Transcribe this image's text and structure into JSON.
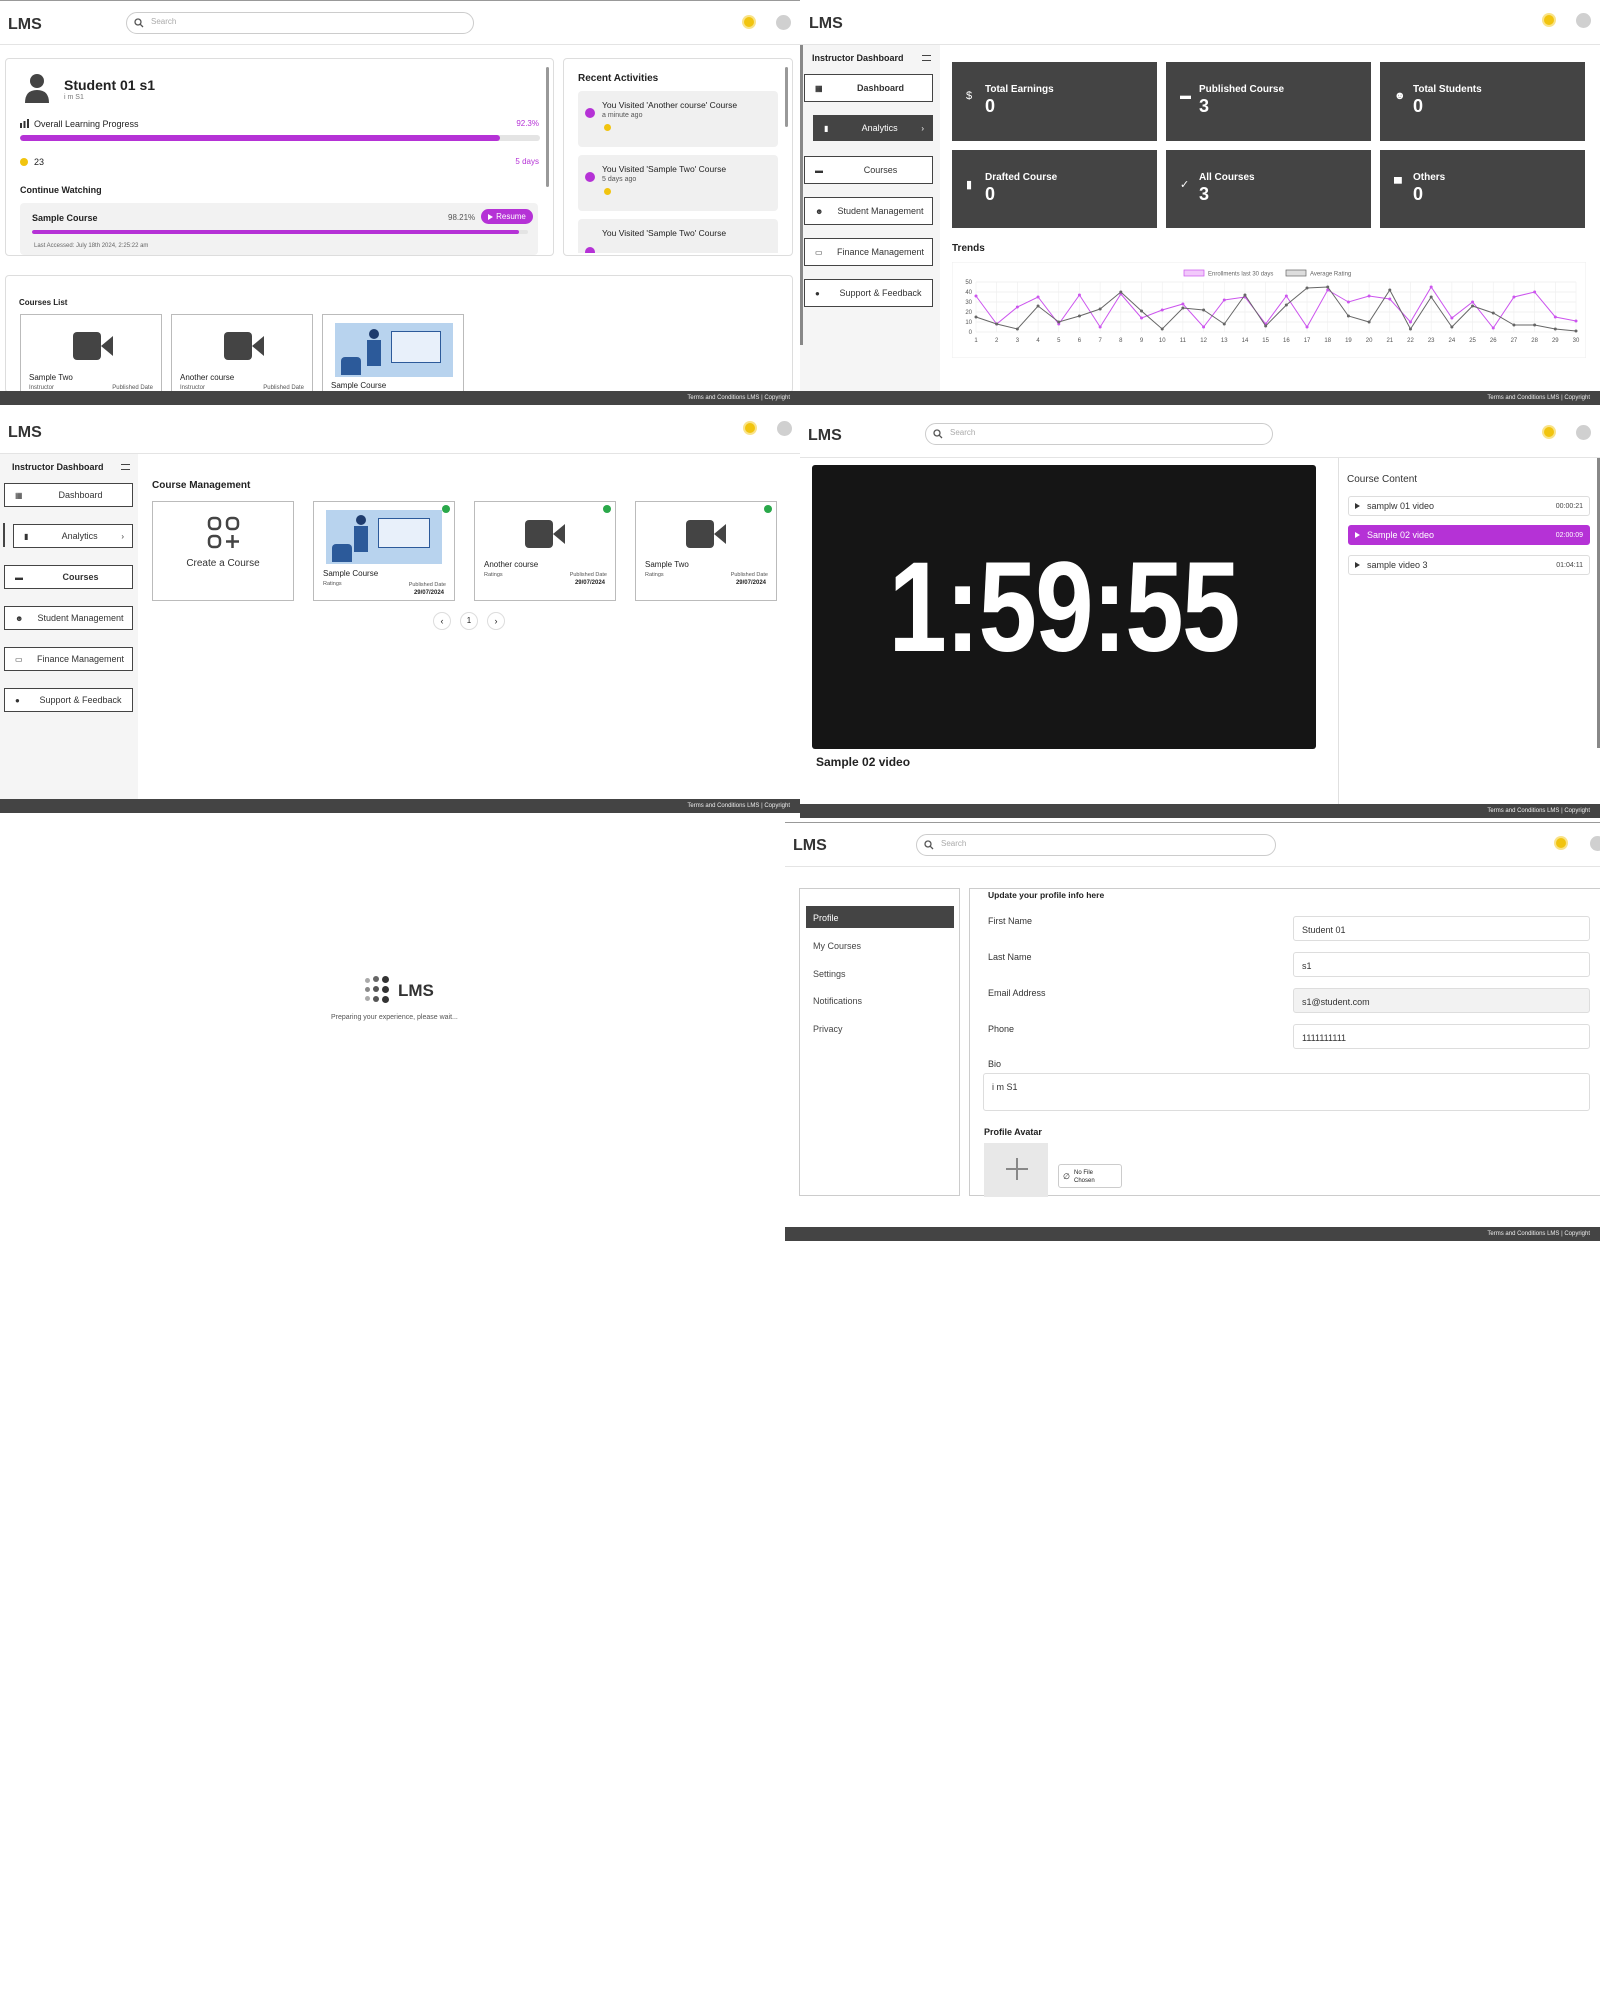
{
  "brand": "LMS",
  "search_placeholder": "Search",
  "footer": "Terms and Conditions  LMS | Copyright",
  "colors": {
    "accent": "#b532d6",
    "dark": "#444444",
    "footer": "#444444",
    "warning": "#f1c40f"
  },
  "student_dashboard": {
    "name": "Student 01 s1",
    "bio": "i m S1",
    "progress_label": "Overall Learning Progress",
    "progress_value": "92.3%",
    "progress": 0.923,
    "points": "23",
    "streak": "5 days",
    "continue_title": "Continue Watching",
    "continue": {
      "course": "Sample Course",
      "pct": "98.21%",
      "progress": 0.9821,
      "resume": "Resume",
      "last_accessed": "Last Accessed: July 18th 2024, 2:25:22 am"
    },
    "recent_title": "Recent Activities",
    "activities": [
      {
        "text": "You Visited 'Another course' Course",
        "time": "a minute ago"
      },
      {
        "text": "You Visited 'Sample Two' Course",
        "time": "5 days ago"
      },
      {
        "text": "You Visited 'Sample Two' Course",
        "time": ""
      }
    ],
    "courses_title": "Courses List",
    "courses": [
      {
        "title": "Sample Two",
        "instructor": "Instructor",
        "date_label": "Published Date"
      },
      {
        "title": "Another course",
        "instructor": "Instructor",
        "date_label": "Published Date"
      },
      {
        "title": "Sample Course",
        "instructor": "",
        "date_label": ""
      }
    ]
  },
  "instructor_dashboard": {
    "title": "Instructor Dashboard",
    "menu": [
      "Dashboard",
      "Analytics",
      "Courses",
      "Student Management",
      "Finance Management",
      "Support & Feedback"
    ],
    "stats": [
      {
        "label": "Total Earnings",
        "value": "0",
        "icon": "dollar-icon"
      },
      {
        "label": "Published Course",
        "value": "3",
        "icon": "book-icon"
      },
      {
        "label": "Total Students",
        "value": "0",
        "icon": "students-icon"
      },
      {
        "label": "Drafted Course",
        "value": "0",
        "icon": "file-icon"
      },
      {
        "label": "All Courses",
        "value": "3",
        "icon": "check-doc-icon"
      },
      {
        "label": "Others",
        "value": "0",
        "icon": "briefcase-icon"
      }
    ],
    "trends_title": "Trends"
  },
  "chart_data": {
    "type": "line",
    "title": "Trends",
    "x": [
      1,
      2,
      3,
      4,
      5,
      6,
      7,
      8,
      9,
      10,
      11,
      12,
      13,
      14,
      15,
      16,
      17,
      18,
      19,
      20,
      21,
      22,
      23,
      24,
      25,
      26,
      27,
      28,
      29,
      30
    ],
    "ylim": [
      0,
      50
    ],
    "yticks": [
      0,
      10,
      20,
      30,
      40,
      50
    ],
    "legend_position": "top-center",
    "grid": true,
    "series": [
      {
        "name": "Enrollments last 30 days",
        "color": "#cc55ee",
        "values": [
          36,
          8,
          25,
          35,
          8,
          37,
          5,
          38,
          14,
          22,
          28,
          5,
          32,
          35,
          8,
          36,
          5,
          42,
          30,
          36,
          33,
          10,
          45,
          14,
          30,
          4,
          35,
          40,
          15,
          11
        ]
      },
      {
        "name": "Average Rating",
        "color": "#666666",
        "values": [
          15,
          8,
          3,
          26,
          10,
          16,
          23,
          40,
          21,
          3,
          24,
          22,
          8,
          37,
          6,
          27,
          44,
          45,
          16,
          10,
          42,
          3,
          35,
          5,
          26,
          19,
          7,
          7,
          3,
          1
        ]
      }
    ]
  },
  "course_management": {
    "title": "Course Management",
    "create": "Create a Course",
    "ratings": "Ratings",
    "date_label": "Published Date",
    "courses": [
      {
        "title": "Sample Course",
        "date": "29/07/2024"
      },
      {
        "title": "Another course",
        "date": "29/07/2024"
      },
      {
        "title": "Sample Two",
        "date": "29/07/2024"
      }
    ],
    "page": "1"
  },
  "player": {
    "timer": "1:59:55",
    "video_title": "Sample 02 video",
    "content_title": "Course Content",
    "items": [
      {
        "title": "samplw 01 video",
        "time": "00:00:21"
      },
      {
        "title": "Sample 02 video",
        "time": "02:00:09"
      },
      {
        "title": "sample video 3",
        "time": "01:04:11"
      }
    ]
  },
  "loading": {
    "text": "Preparing your experience, please wait..."
  },
  "profile": {
    "menu": [
      "Profile",
      "My Courses",
      "Settings",
      "Notifications",
      "Privacy"
    ],
    "heading": "Update your profile info here",
    "first_name_label": "First Name",
    "first_name": "Student 01",
    "last_name_label": "Last Name",
    "last_name": "s1",
    "email_label": "Email Address",
    "email": "s1@student.com",
    "phone_label": "Phone",
    "phone": "1111111111",
    "bio_label": "Bio",
    "bio": "i m S1",
    "avatar_label": "Profile Avatar",
    "file_text": "No File Chosen"
  }
}
